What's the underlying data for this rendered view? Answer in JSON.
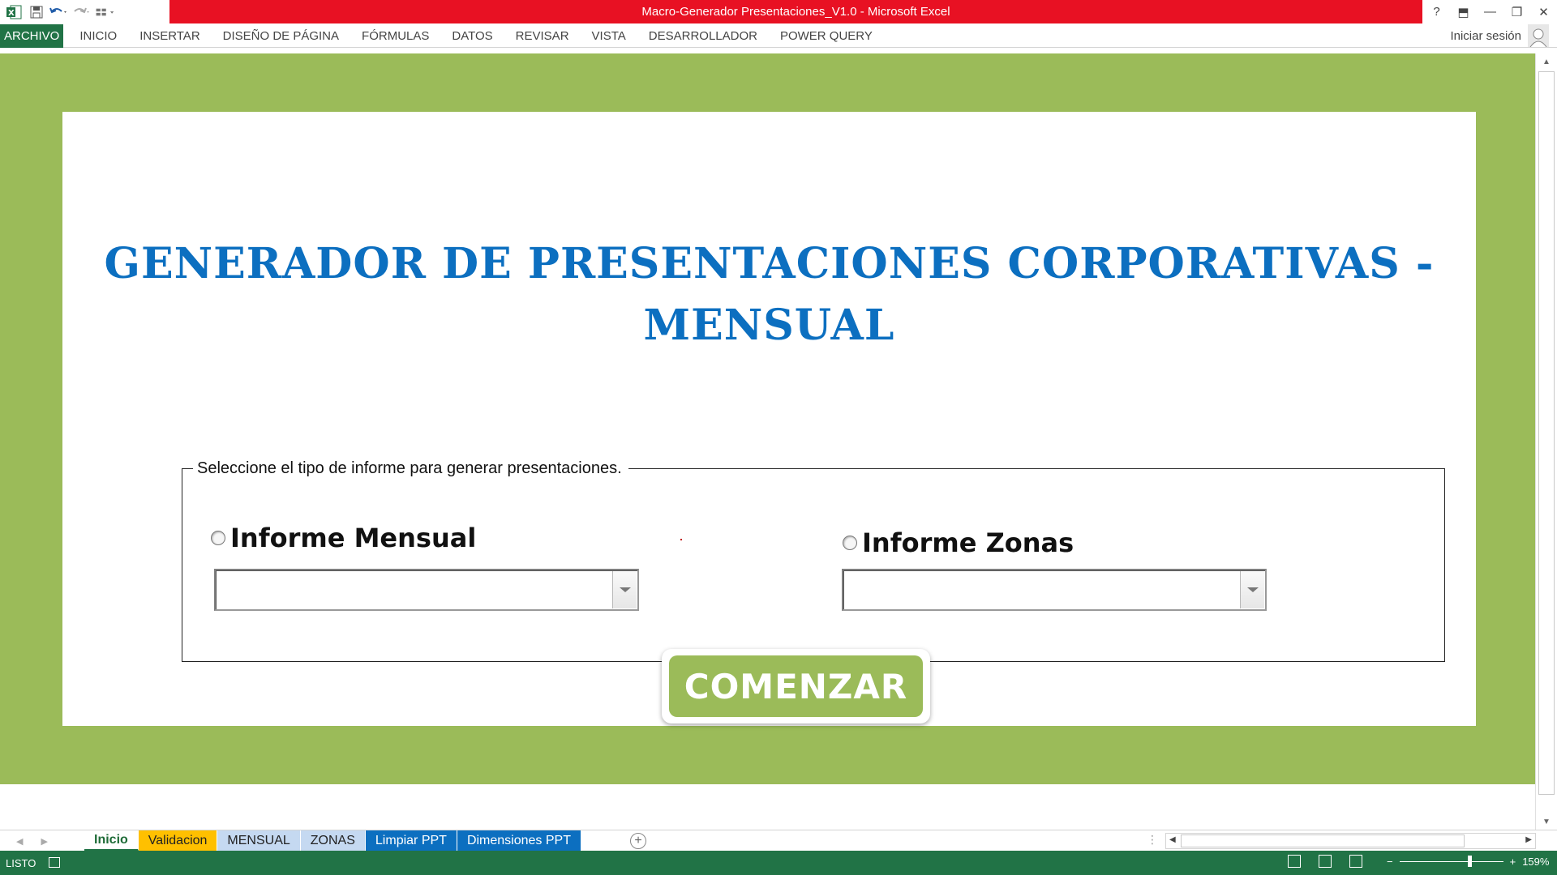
{
  "window": {
    "title": "Macro-Generador Presentaciones_V1.0 -  Microsoft Excel",
    "controls": [
      "?",
      "⬒",
      "—",
      "❐",
      "✕"
    ]
  },
  "qat": {
    "icons": [
      "excel-logo-icon",
      "save-icon",
      "undo-icon",
      "redo-icon",
      "customize-qat-icon"
    ]
  },
  "ribbon": {
    "tabs": [
      "ARCHIVO",
      "INICIO",
      "INSERTAR",
      "DISEÑO DE PÁGINA",
      "FÓRMULAS",
      "DATOS",
      "REVISAR",
      "VISTA",
      "DESARROLLADOR",
      "POWER QUERY"
    ],
    "signin_label": "Iniciar sesión"
  },
  "sheet": {
    "title_line1": "GENERADOR DE PRESENTACIONES CORPORATIVAS -",
    "title_line2": "MENSUAL",
    "group_label": "Seleccione el tipo de informe para generar presentaciones.",
    "option_mensual": "Informe Mensual",
    "option_zonas": "Informe Zonas",
    "combo_mensual_value": "",
    "combo_zonas_value": "",
    "start_button": "COMENZAR",
    "colors": {
      "band": "#9bbb59",
      "title": "#0c6fc0",
      "button": "#9bbb59"
    }
  },
  "sheet_tabs": [
    {
      "label": "Inicio",
      "bg": "#ffffff",
      "fg": "#1e6b37",
      "active": true
    },
    {
      "label": "Validacion",
      "bg": "#ffc000",
      "fg": "#222222",
      "active": false
    },
    {
      "label": "MENSUAL",
      "bg": "#c5d9f1",
      "fg": "#222222",
      "active": false
    },
    {
      "label": "ZONAS",
      "bg": "#c5d9f1",
      "fg": "#222222",
      "active": false
    },
    {
      "label": "Limpiar PPT",
      "bg": "#0c6fc0",
      "fg": "#ffffff",
      "active": false
    },
    {
      "label": "Dimensiones PPT",
      "bg": "#0c6fc0",
      "fg": "#ffffff",
      "active": false
    }
  ],
  "status": {
    "ready": "LISTO",
    "zoom": "159%"
  }
}
